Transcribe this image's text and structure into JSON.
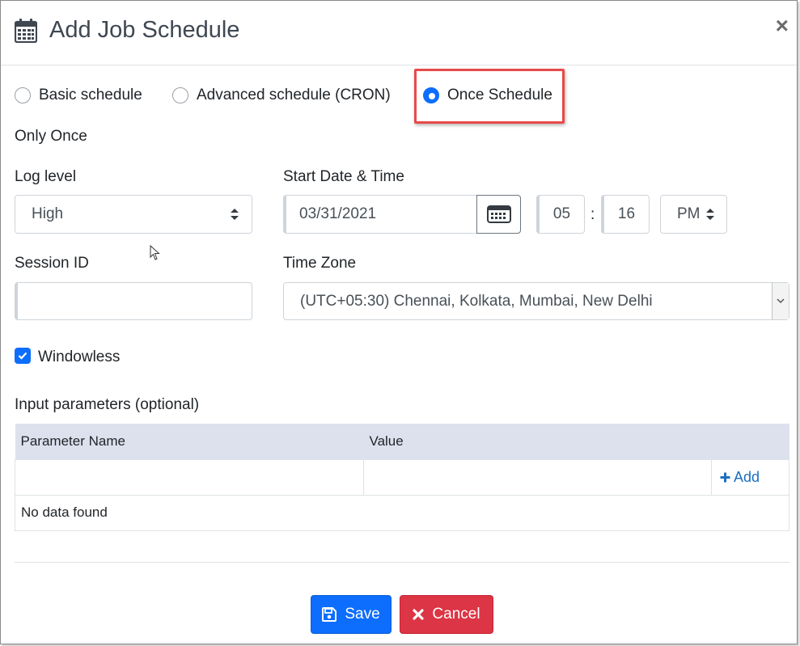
{
  "header": {
    "title": "Add Job Schedule",
    "close_label": "×",
    "icon": "calendar-icon"
  },
  "schedule_types": [
    {
      "label": "Basic schedule",
      "selected": false
    },
    {
      "label": "Advanced schedule (CRON)",
      "selected": false
    },
    {
      "label": "Once Schedule",
      "selected": true
    }
  ],
  "section_label": "Only Once",
  "log_level": {
    "label": "Log level",
    "value": "High"
  },
  "start": {
    "label": "Start Date & Time",
    "date": "03/31/2021",
    "hour": "05",
    "separator": ":",
    "minute": "16",
    "meridiem": "PM"
  },
  "session": {
    "label": "Session ID",
    "value": ""
  },
  "timezone": {
    "label": "Time Zone",
    "value": "(UTC+05:30) Chennai, Kolkata, Mumbai, New Delhi"
  },
  "windowless": {
    "label": "Windowless",
    "checked": true
  },
  "params": {
    "label": "Input parameters (optional)",
    "columns": [
      "Parameter Name",
      "Value"
    ],
    "add_label": "Add",
    "empty_text": "No data found"
  },
  "footer": {
    "save_label": "Save",
    "cancel_label": "Cancel"
  },
  "colors": {
    "primary": "#0d6efd",
    "danger": "#dc3545",
    "highlight": "#e84a4a",
    "table_header": "#dde1ee"
  }
}
